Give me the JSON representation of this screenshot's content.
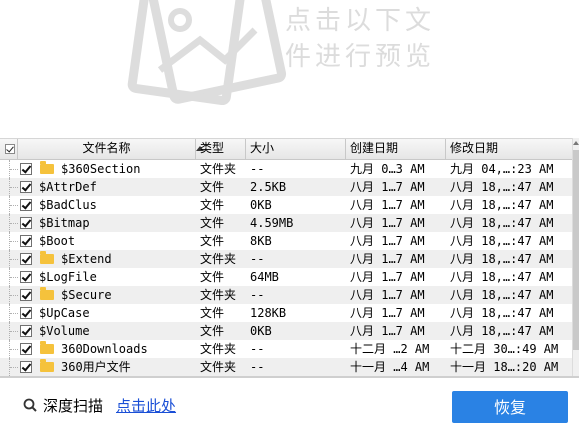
{
  "watermark": {
    "line1": "点击以下文",
    "line2": "件进行预览"
  },
  "table": {
    "headers": {
      "name": "文件名称",
      "type": "类型",
      "size": "大小",
      "created": "创建日期",
      "modified": "修改日期"
    },
    "rows": [
      {
        "name": "$360Section",
        "type": "文件夹",
        "size": "--",
        "created": "九月 0…3 AM",
        "modified": "九月 04,…:23 AM",
        "folder": true
      },
      {
        "name": "$AttrDef",
        "type": "文件",
        "size": "2.5KB",
        "created": "八月 1…7 AM",
        "modified": "八月 18,…:47 AM",
        "folder": false
      },
      {
        "name": "$BadClus",
        "type": "文件",
        "size": "0KB",
        "created": "八月 1…7 AM",
        "modified": "八月 18,…:47 AM",
        "folder": false
      },
      {
        "name": "$Bitmap",
        "type": "文件",
        "size": "4.59MB",
        "created": "八月 1…7 AM",
        "modified": "八月 18,…:47 AM",
        "folder": false
      },
      {
        "name": "$Boot",
        "type": "文件",
        "size": "8KB",
        "created": "八月 1…7 AM",
        "modified": "八月 18,…:47 AM",
        "folder": false
      },
      {
        "name": "$Extend",
        "type": "文件夹",
        "size": "--",
        "created": "八月 1…7 AM",
        "modified": "八月 18,…:47 AM",
        "folder": true
      },
      {
        "name": "$LogFile",
        "type": "文件",
        "size": "64MB",
        "created": "八月 1…7 AM",
        "modified": "八月 18,…:47 AM",
        "folder": false
      },
      {
        "name": "$Secure",
        "type": "文件夹",
        "size": "--",
        "created": "八月 1…7 AM",
        "modified": "八月 18,…:47 AM",
        "folder": true
      },
      {
        "name": "$UpCase",
        "type": "文件",
        "size": "128KB",
        "created": "八月 1…7 AM",
        "modified": "八月 18,…:47 AM",
        "folder": false
      },
      {
        "name": "$Volume",
        "type": "文件",
        "size": "0KB",
        "created": "八月 1…7 AM",
        "modified": "八月 18,…:47 AM",
        "folder": false
      },
      {
        "name": "360Downloads",
        "type": "文件夹",
        "size": "--",
        "created": "十二月 …2 AM",
        "modified": "十二月 30…:49 AM",
        "folder": true
      },
      {
        "name": "360用户文件",
        "type": "文件夹",
        "size": "--",
        "created": "十一月 …4 AM",
        "modified": "十一月 18…:20 AM",
        "folder": true
      }
    ]
  },
  "bottom": {
    "deep_scan_label": "深度扫描",
    "click_here_label": "点击此处",
    "recover_label": "恢复"
  },
  "colors": {
    "accent": "#2a82e4",
    "link": "#1a4fd6",
    "folder": "#f5c23c"
  }
}
